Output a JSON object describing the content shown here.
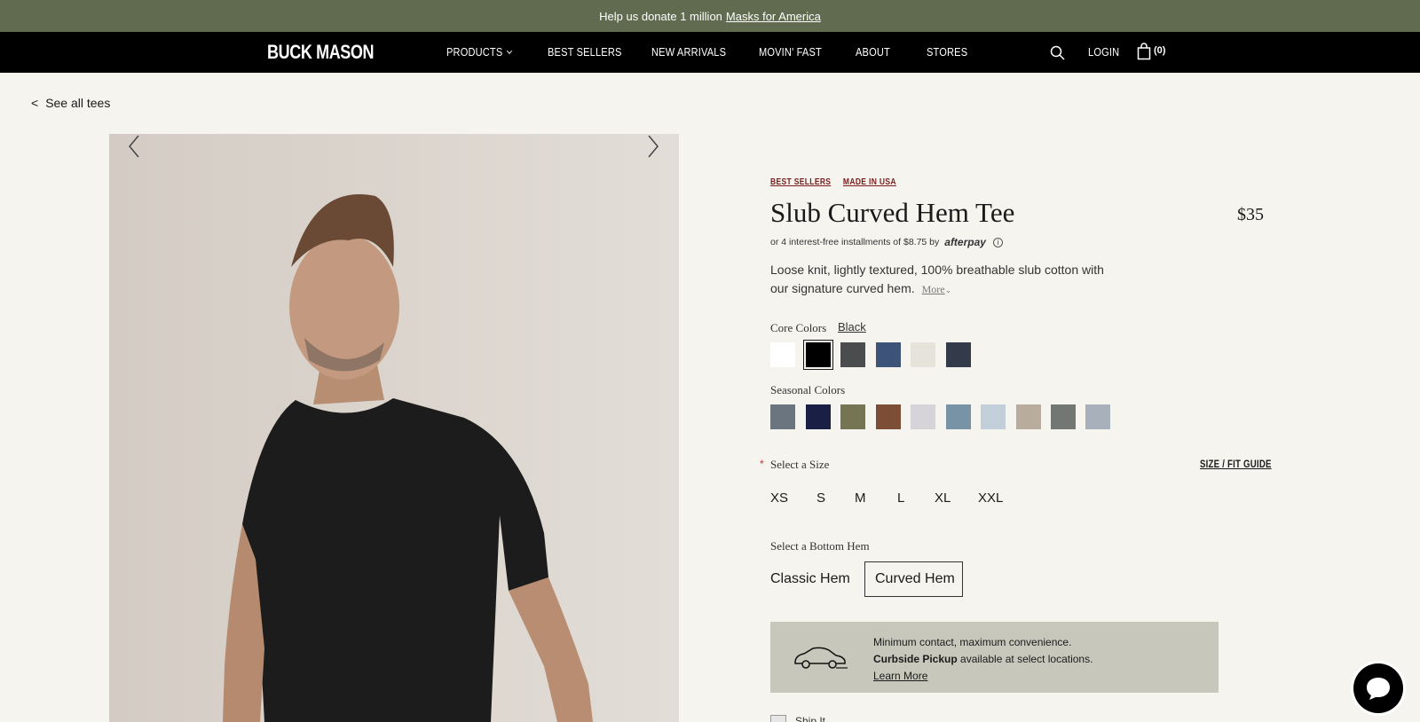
{
  "promo": {
    "text": "Help us donate 1 million",
    "link": "Masks for America"
  },
  "nav": {
    "logo": "BUCK MASON",
    "items": [
      "PRODUCTS",
      "BEST SELLERS",
      "NEW ARRIVALS",
      "MOVIN' FAST",
      "ABOUT",
      "STORES"
    ],
    "login": "LOGIN",
    "cart_count": "(0)"
  },
  "breadcrumb": {
    "arrow": "<",
    "label": "See all tees"
  },
  "product": {
    "tags": [
      "BEST SELLERS",
      "MADE IN USA"
    ],
    "title": "Slub Curved Hem Tee",
    "price": "$35",
    "afterpay_text": "or 4 interest-free installments of $8.75 by",
    "afterpay_logo": "afterpay",
    "description": "Loose knit, lightly textured, 100% breathable slub cotton with our signature curved hem.",
    "more_label": "More"
  },
  "colors": {
    "core_label": "Core Colors",
    "core_selected": "Black",
    "core": [
      "#ffffff",
      "#000000",
      "#4b4c4e",
      "#3d5378",
      "#e6e4da",
      "#333a49"
    ],
    "seasonal_label": "Seasonal Colors",
    "seasonal": [
      "#6b7580",
      "#1a1f45",
      "#757553",
      "#7d4e36",
      "#d6d4d9",
      "#7893a6",
      "#c2cfd9",
      "#b8ad9c",
      "#737774",
      "#a8b0bb"
    ]
  },
  "size": {
    "label": "Select a Size",
    "required_mark": "*",
    "guide": "SIZE / FIT GUIDE",
    "options": [
      "XS",
      "S",
      "M",
      "L",
      "XL",
      "XXL"
    ]
  },
  "hem": {
    "label": "Select a Bottom Hem",
    "options": [
      "Classic Hem",
      "Curved Hem"
    ],
    "selected": "Curved Hem"
  },
  "pickup": {
    "line1": "Minimum contact, maximum convenience.",
    "bold": "Curbside Pickup",
    "line2_rest": " available at select locations.",
    "link": "Learn More"
  },
  "checkbox_label": "Ship It"
}
